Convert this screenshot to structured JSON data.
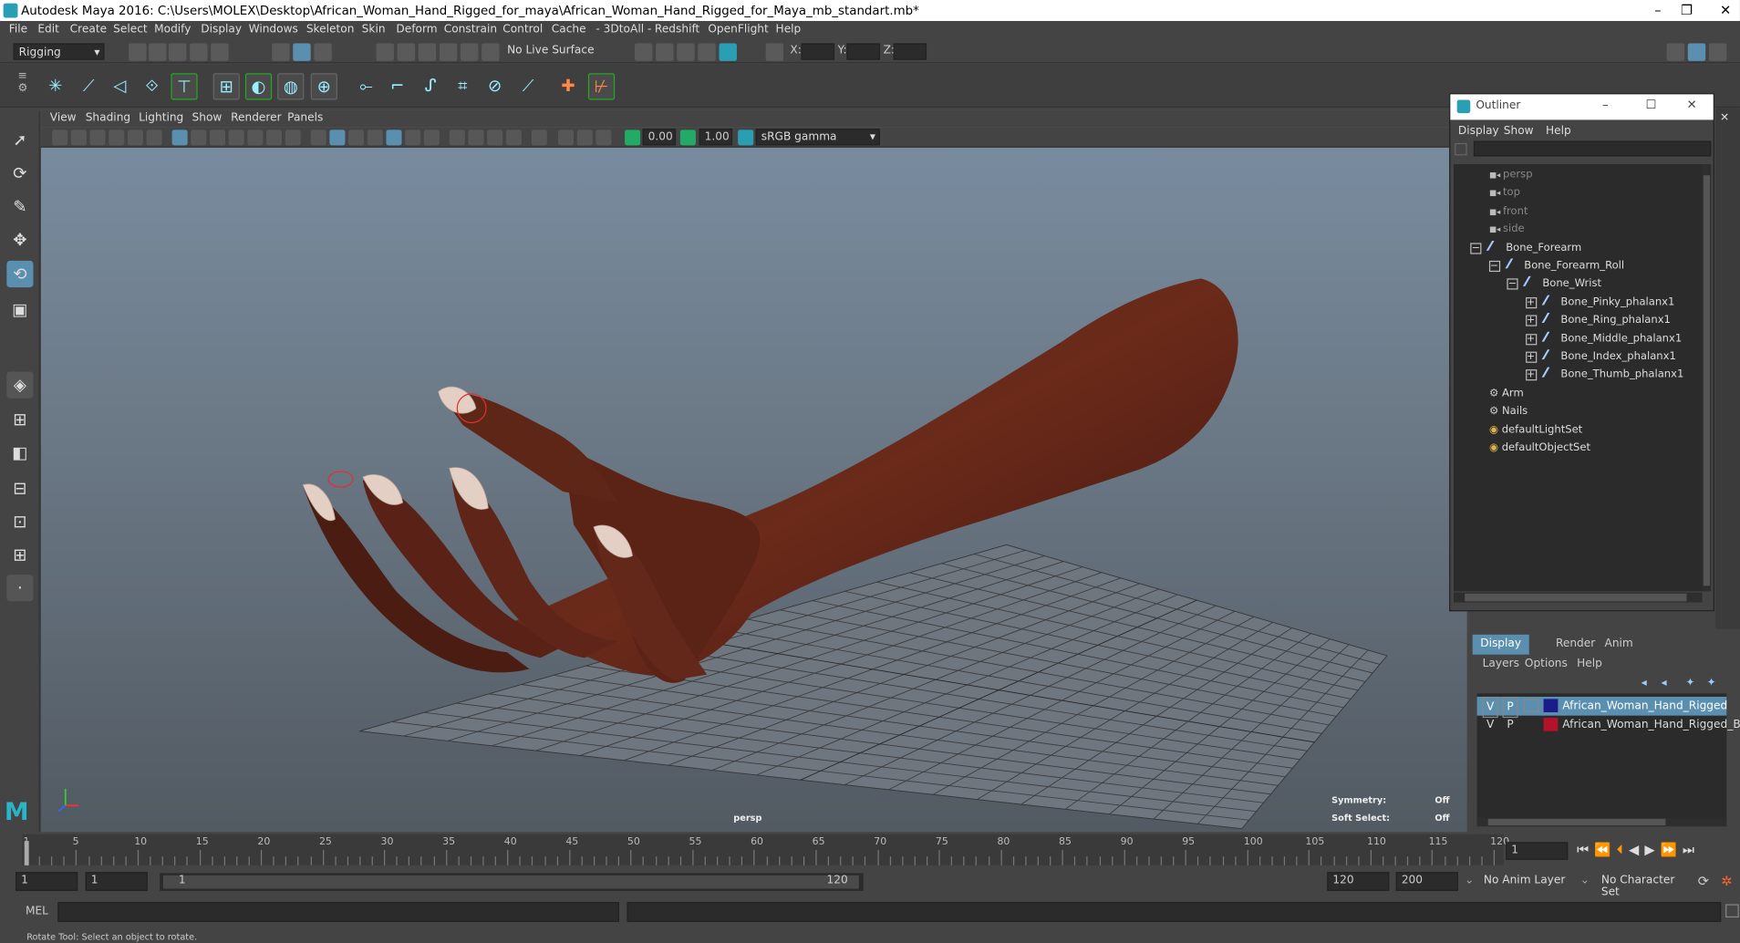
{
  "window": {
    "title": "Autodesk Maya 2016: C:\\Users\\MOLEX\\Desktop\\African_Woman_Hand_Rigged_for_maya\\African_Woman_Hand_Rigged_for_Maya_mb_standart.mb*",
    "minimize": "–",
    "restore": "❐",
    "close": "✕"
  },
  "menubar": [
    "File",
    "Edit",
    "Create",
    "Select",
    "Modify",
    "Display",
    "Windows",
    "Skeleton",
    "Skin",
    "Deform",
    "Constrain",
    "Control",
    "Cache",
    "- 3DtoAll -",
    "Redshift",
    "OpenFlight",
    "Help"
  ],
  "status": {
    "menuset": "Rigging",
    "live_surface": "No Live Surface",
    "x_label": "X:",
    "y_label": "Y:",
    "z_label": "Z:"
  },
  "panel": {
    "menu": [
      "View",
      "Shading",
      "Lighting",
      "Show",
      "Renderer",
      "Panels"
    ],
    "exposure": "0.00",
    "gamma": "1.00",
    "colorspace": "sRGB gamma",
    "camera": "persp",
    "symmetry_label": "Symmetry:",
    "symmetry_value": "Off",
    "softselect_label": "Soft Select:",
    "softselect_value": "Off"
  },
  "outliner": {
    "title": "Outliner",
    "menu": [
      "Display",
      "Show",
      "Help"
    ],
    "items": [
      {
        "label": "persp",
        "type": "camera",
        "indent": 0
      },
      {
        "label": "top",
        "type": "camera",
        "indent": 0
      },
      {
        "label": "front",
        "type": "camera",
        "indent": 0
      },
      {
        "label": "side",
        "type": "camera",
        "indent": 0
      },
      {
        "label": "Bone_Forearm",
        "type": "joint",
        "indent": 0,
        "expander": "−"
      },
      {
        "label": "Bone_Forearm_Roll",
        "type": "joint",
        "indent": 1,
        "expander": "−"
      },
      {
        "label": "Bone_Wrist",
        "type": "joint",
        "indent": 2,
        "expander": "−"
      },
      {
        "label": "Bone_Pinky_phalanx1",
        "type": "joint",
        "indent": 3,
        "expander": "+"
      },
      {
        "label": "Bone_Ring_phalanx1",
        "type": "joint",
        "indent": 3,
        "expander": "+"
      },
      {
        "label": "Bone_Middle_phalanx1",
        "type": "joint",
        "indent": 3,
        "expander": "+"
      },
      {
        "label": "Bone_Index_phalanx1",
        "type": "joint",
        "indent": 3,
        "expander": "+"
      },
      {
        "label": "Bone_Thumb_phalanx1",
        "type": "joint",
        "indent": 3,
        "expander": "+"
      },
      {
        "label": "Arm",
        "type": "set",
        "indent": 0
      },
      {
        "label": "Nails",
        "type": "set",
        "indent": 0
      },
      {
        "label": "defaultLightSet",
        "type": "objset",
        "indent": 0
      },
      {
        "label": "defaultObjectSet",
        "type": "objset",
        "indent": 0
      }
    ]
  },
  "channelbox": {
    "tabs": [
      "Display",
      "Render",
      "Anim"
    ],
    "menu": [
      "Layers",
      "Options",
      "Help"
    ],
    "layers": [
      {
        "v": "V",
        "p": "P",
        "color": "#1b1b8a",
        "name": "African_Woman_Hand_Rigged",
        "selected": true
      },
      {
        "v": "V",
        "p": "P",
        "color": "#b3122a",
        "name": "African_Woman_Hand_Rigged_Bon",
        "selected": false
      }
    ]
  },
  "timeline": {
    "ticks": [
      "1",
      "5",
      "10",
      "15",
      "20",
      "25",
      "30",
      "35",
      "40",
      "45",
      "50",
      "55",
      "60",
      "65",
      "70",
      "75",
      "80",
      "85",
      "90",
      "95",
      "100",
      "105",
      "110",
      "115",
      "120"
    ],
    "current_frame": "1"
  },
  "range": {
    "start": "1",
    "playback_start": "1",
    "slider_start": "1",
    "slider_end": "120",
    "playback_end": "120",
    "end": "200",
    "anim_layer": "No Anim Layer",
    "character_set": "No Character Set"
  },
  "cmdline": {
    "label": "MEL"
  },
  "helpline": "Rotate Tool: Select an object to rotate."
}
